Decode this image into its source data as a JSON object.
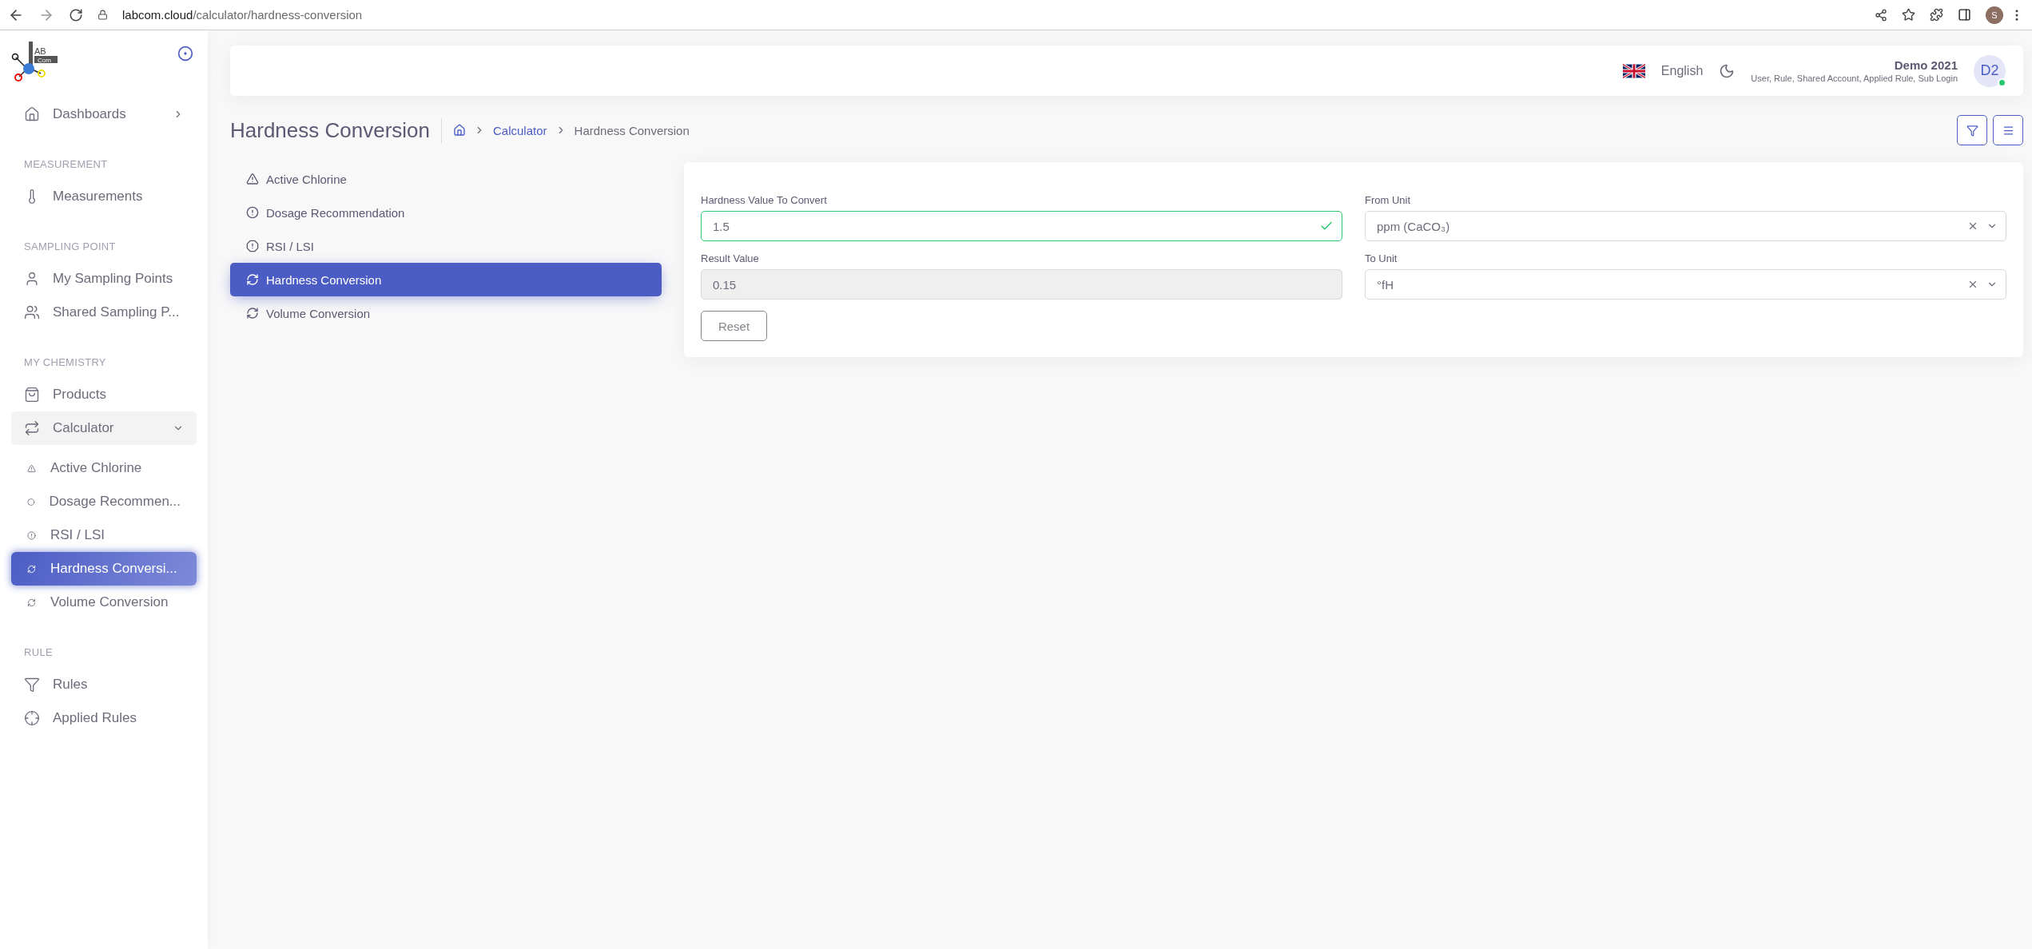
{
  "browser": {
    "url": "**labcom.cloud**/calculator/hardness-conversion",
    "profile": "S"
  },
  "sidebar": {
    "logo": [
      "AB",
      "Com"
    ],
    "items": [
      {
        "kind": "link",
        "label": "Dashboards",
        "expanded": false
      },
      {
        "kind": "section",
        "label": "MEASUREMENT"
      },
      {
        "kind": "link",
        "label": "Measurements"
      },
      {
        "kind": "section",
        "label": "SAMPLING POINT"
      },
      {
        "kind": "link",
        "label": "My Sampling Points"
      },
      {
        "kind": "link",
        "label": "Shared Sampling P..."
      },
      {
        "kind": "section",
        "label": "MY CHEMISTRY"
      },
      {
        "kind": "link",
        "label": "Products"
      },
      {
        "kind": "link",
        "label": "Calculator",
        "expanded": true,
        "children": [
          {
            "label": "Active Chlorine",
            "selected": false
          },
          {
            "label": "Dosage Recommen...",
            "selected": false
          },
          {
            "label": "RSI / LSI",
            "selected": false
          },
          {
            "label": "Hardness Conversi...",
            "selected": true
          },
          {
            "label": "Volume Conversion",
            "selected": false
          }
        ]
      },
      {
        "kind": "section",
        "label": "RULE"
      },
      {
        "kind": "link",
        "label": "Rules"
      },
      {
        "kind": "link",
        "label": "Applied Rules"
      }
    ]
  },
  "header": {
    "language": "English",
    "user": {
      "name": "Demo 2021",
      "roles": "User, Rule, Shared Account, Applied Rule, Sub Login",
      "initials": "D2",
      "online": true
    }
  },
  "page": {
    "title": "Hardness Conversion",
    "breadcrumb": [
      {
        "label": "Calculator",
        "link": true
      },
      {
        "label": "Hardness Conversion",
        "link": false
      }
    ]
  },
  "calc_menu": [
    {
      "label": "Active Chlorine",
      "selected": false
    },
    {
      "label": "Dosage Recommendation",
      "selected": false
    },
    {
      "label": "RSI / LSI",
      "selected": false
    },
    {
      "label": "Hardness Conversion",
      "selected": true
    },
    {
      "label": "Volume Conversion",
      "selected": false
    }
  ],
  "form": {
    "fields": [
      {
        "kind": "input",
        "label": "Hardness Value To Convert",
        "value": "1.5",
        "valid": true
      },
      {
        "kind": "select",
        "label": "From Unit",
        "value": "ppm (CaCO₃)"
      },
      {
        "kind": "readonly",
        "label": "Result Value",
        "value": "0.15"
      },
      {
        "kind": "select",
        "label": "To Unit",
        "value": "°fH"
      }
    ],
    "reset": "Reset"
  }
}
